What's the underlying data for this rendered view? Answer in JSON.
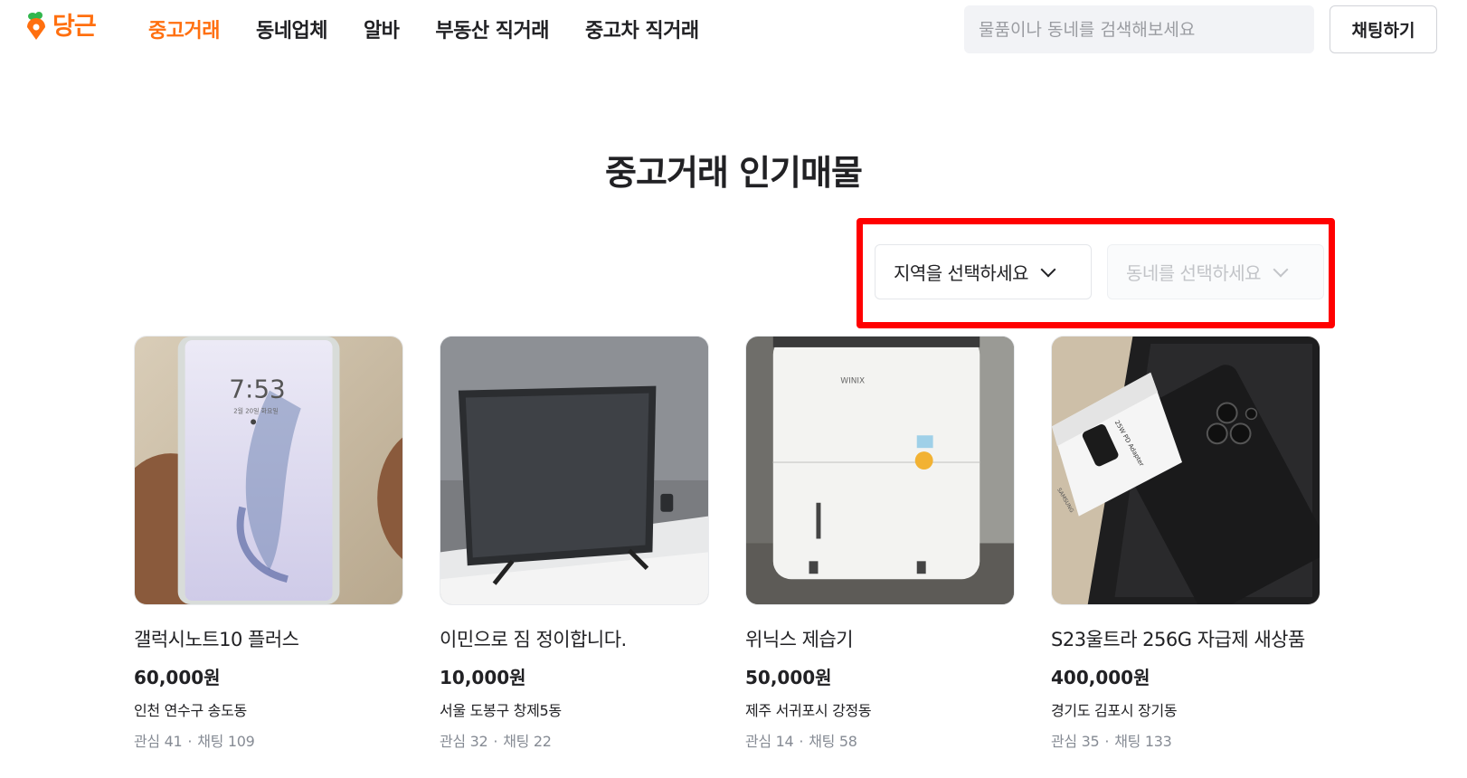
{
  "header": {
    "logo_text": "당근",
    "nav": [
      "중고거래",
      "동네업체",
      "알바",
      "부동산 직거래",
      "중고차 직거래"
    ],
    "search_placeholder": "물품이나 동네를 검색해보세요",
    "chat_button": "채팅하기"
  },
  "colors": {
    "brand": "#ff6f0f",
    "highlight": "#ff0000",
    "muted": "#868b94"
  },
  "page_title": "중고거래 인기매물",
  "filters": {
    "region_label": "지역을 선택하세요",
    "town_label": "동네를 선택하세요",
    "icon": "chevron-down-icon"
  },
  "products": [
    {
      "title": "갤럭시노트10 플러스",
      "price": "60,000원",
      "location": "인천 연수구 송도동",
      "likes": "관심 41",
      "chats": "채팅 109",
      "image_clock": "7:53",
      "image_date": "2월 20일 화요일"
    },
    {
      "title": "이민으로 짐 정이합니다.",
      "price": "10,000원",
      "location": "서울 도봉구 창제5동",
      "likes": "관심 32",
      "chats": "채팅 22"
    },
    {
      "title": "위닉스 제습기",
      "price": "50,000원",
      "location": "제주 서귀포시 강정동",
      "likes": "관심 14",
      "chats": "채팅 58",
      "image_brand": "WINIX"
    },
    {
      "title": "S23울트라 256G 자급제 새상품",
      "price": "400,000원",
      "location": "경기도 김포시 장기동",
      "likes": "관심 35",
      "chats": "채팅 133",
      "image_box_text": "25W PD Adapter",
      "image_brand": "SAMSUNG"
    }
  ]
}
